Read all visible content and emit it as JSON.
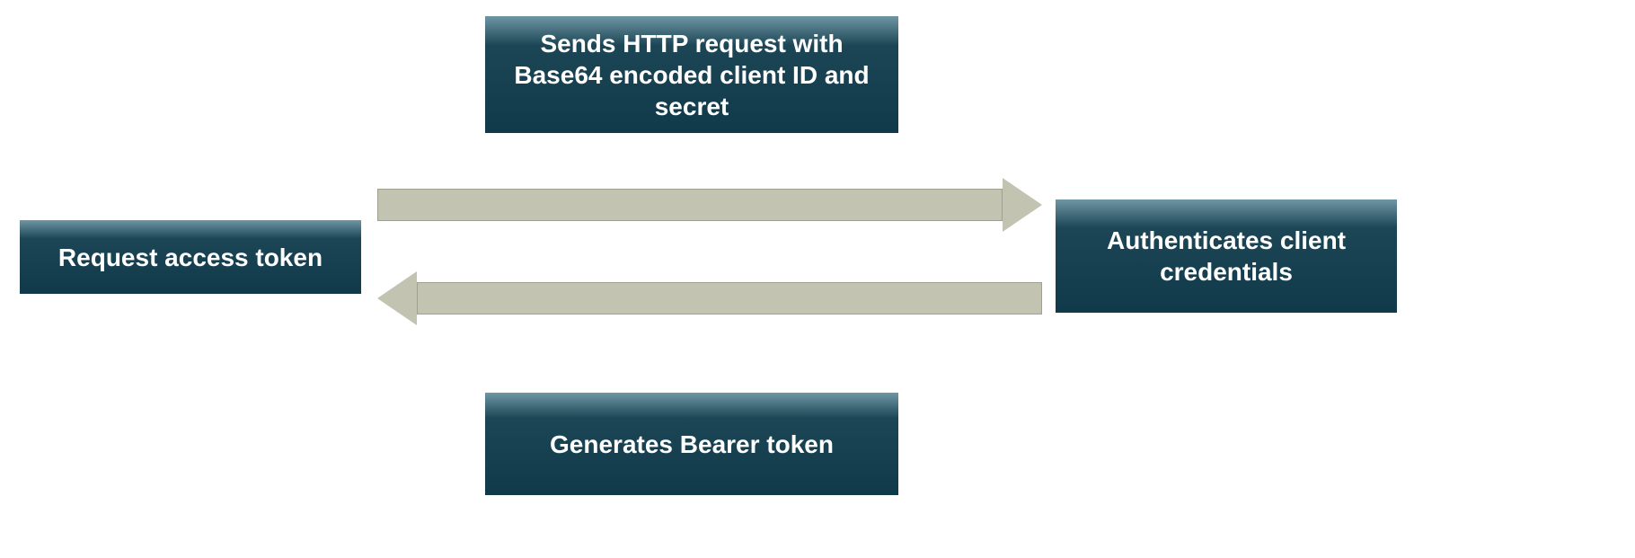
{
  "diagram": {
    "top_box": "Sends HTTP request with Base64 encoded client ID and secret",
    "left_box": "Request access token",
    "right_box": "Authenticates client credentials",
    "bottom_box": "Generates Bearer token",
    "arrows": {
      "forward": "right",
      "backward": "left"
    },
    "colors": {
      "box_gradient_top": "#6f96a4",
      "box_gradient_mid": "#1c4656",
      "box_gradient_bottom": "#10394a",
      "arrow_fill": "#c2c3b0",
      "arrow_border": "#9fa08e",
      "text": "#ffffff"
    }
  }
}
